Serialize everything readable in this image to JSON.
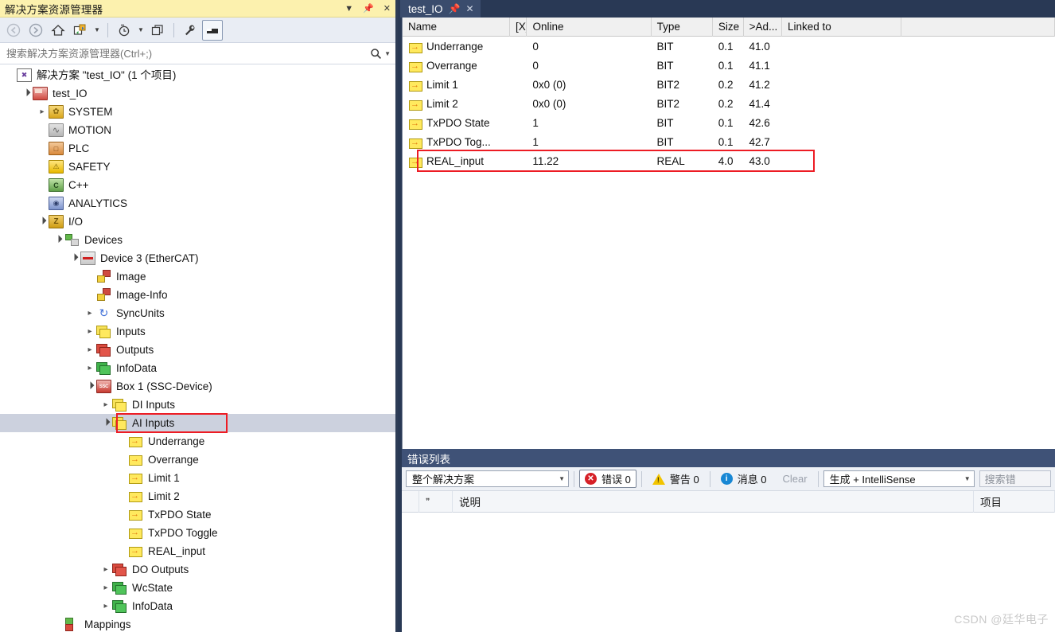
{
  "solution_explorer": {
    "title": "解决方案资源管理器",
    "title_icons": [
      "caret-down-icon",
      "pin-icon",
      "close-icon"
    ],
    "toolbar": {
      "back_label": "back-icon",
      "forward_label": "forward-icon",
      "home_label": "home-icon",
      "sync_label": "sync-with-active-document-icon",
      "pending_changes_label": "pending-changes-icon",
      "refresh_label": "refresh-icon",
      "properties_label": "properties-icon",
      "preview_label": "preview-selected-items-icon"
    },
    "search": {
      "placeholder": "搜索解决方案资源管理器(Ctrl+;)",
      "value": "",
      "icon": "search-icon"
    },
    "tree": [
      {
        "label": "解决方案 \"test_IO\" (1 个项目)",
        "indent": 0,
        "twist": "none",
        "icon": "ic-sln"
      },
      {
        "label": "test_IO",
        "indent": 1,
        "twist": "open",
        "icon": "ic-proj"
      },
      {
        "label": "SYSTEM",
        "indent": 2,
        "twist": "closed",
        "icon": "ic-sys"
      },
      {
        "label": "MOTION",
        "indent": 2,
        "twist": "none",
        "icon": "ic-motion"
      },
      {
        "label": "PLC",
        "indent": 2,
        "twist": "none",
        "icon": "ic-plc"
      },
      {
        "label": "SAFETY",
        "indent": 2,
        "twist": "none",
        "icon": "ic-safety"
      },
      {
        "label": "C++",
        "indent": 2,
        "twist": "none",
        "icon": "ic-cpp"
      },
      {
        "label": "ANALYTICS",
        "indent": 2,
        "twist": "none",
        "icon": "ic-analytics"
      },
      {
        "label": "I/O",
        "indent": 2,
        "twist": "open",
        "icon": "ic-io"
      },
      {
        "label": "Devices",
        "indent": 3,
        "twist": "open",
        "icon": "ic-devices"
      },
      {
        "label": "Device 3 (EtherCAT)",
        "indent": 4,
        "twist": "open",
        "icon": "ic-device3"
      },
      {
        "label": "Image",
        "indent": 5,
        "twist": "none",
        "icon": "ic-image"
      },
      {
        "label": "Image-Info",
        "indent": 5,
        "twist": "none",
        "icon": "ic-image"
      },
      {
        "label": "SyncUnits",
        "indent": 5,
        "twist": "closed",
        "icon": "ic-sync"
      },
      {
        "label": "Inputs",
        "indent": 5,
        "twist": "closed",
        "icon": "ic-yellow"
      },
      {
        "label": "Outputs",
        "indent": 5,
        "twist": "closed",
        "icon": "ic-red"
      },
      {
        "label": "InfoData",
        "indent": 5,
        "twist": "closed",
        "icon": "ic-green"
      },
      {
        "label": "Box 1 (SSC-Device)",
        "indent": 5,
        "twist": "open",
        "icon": "ic-box"
      },
      {
        "label": "DI Inputs",
        "indent": 6,
        "twist": "closed",
        "icon": "ic-yellow"
      },
      {
        "label": "AI Inputs",
        "indent": 6,
        "twist": "open",
        "icon": "ic-yellow",
        "selected": true,
        "highlighted": true
      },
      {
        "label": "Underrange",
        "indent": 7,
        "twist": "none",
        "icon": "ic-var"
      },
      {
        "label": "Overrange",
        "indent": 7,
        "twist": "none",
        "icon": "ic-var"
      },
      {
        "label": "Limit 1",
        "indent": 7,
        "twist": "none",
        "icon": "ic-var"
      },
      {
        "label": "Limit 2",
        "indent": 7,
        "twist": "none",
        "icon": "ic-var"
      },
      {
        "label": "TxPDO State",
        "indent": 7,
        "twist": "none",
        "icon": "ic-var"
      },
      {
        "label": "TxPDO Toggle",
        "indent": 7,
        "twist": "none",
        "icon": "ic-var"
      },
      {
        "label": "REAL_input",
        "indent": 7,
        "twist": "none",
        "icon": "ic-var"
      },
      {
        "label": "DO Outputs",
        "indent": 6,
        "twist": "closed",
        "icon": "ic-red"
      },
      {
        "label": "WcState",
        "indent": 6,
        "twist": "closed",
        "icon": "ic-green"
      },
      {
        "label": "InfoData",
        "indent": 6,
        "twist": "closed",
        "icon": "ic-green"
      },
      {
        "label": "Mappings",
        "indent": 3,
        "twist": "none",
        "icon": "ic-map"
      }
    ],
    "highlight_color": "#ed1c24",
    "selected_row_color": "#ccd1de"
  },
  "document": {
    "tab": {
      "label": "test_IO",
      "pin_icon": "pin-icon",
      "close_icon": "close-icon"
    },
    "table": {
      "columns": [
        "Name",
        "[X]",
        "Online",
        "Type",
        "Size",
        ">Ad...",
        "Linked to",
        ""
      ],
      "rows": [
        {
          "name": "Underrange",
          "x": "",
          "online": "0",
          "type": "BIT",
          "size": "0.1",
          "addr": "41.0",
          "linked": ""
        },
        {
          "name": "Overrange",
          "x": "",
          "online": "0",
          "type": "BIT",
          "size": "0.1",
          "addr": "41.1",
          "linked": ""
        },
        {
          "name": "Limit 1",
          "x": "",
          "online": "0x0 (0)",
          "type": "BIT2",
          "size": "0.2",
          "addr": "41.2",
          "linked": ""
        },
        {
          "name": "Limit 2",
          "x": "",
          "online": "0x0 (0)",
          "type": "BIT2",
          "size": "0.2",
          "addr": "41.4",
          "linked": ""
        },
        {
          "name": "TxPDO State",
          "x": "",
          "online": "1",
          "type": "BIT",
          "size": "0.1",
          "addr": "42.6",
          "linked": ""
        },
        {
          "name": "TxPDO Tog...",
          "x": "",
          "online": "1",
          "type": "BIT",
          "size": "0.1",
          "addr": "42.7",
          "linked": ""
        },
        {
          "name": "REAL_input",
          "x": "",
          "online": "11.22",
          "type": "REAL",
          "size": "4.0",
          "addr": "43.0",
          "linked": "",
          "highlighted": true
        }
      ]
    }
  },
  "error_list": {
    "title": "错误列表",
    "scope": {
      "value": "整个解决方案",
      "caret": "chevron-down-icon"
    },
    "errors": {
      "label": "错误 0",
      "icon": "error-icon",
      "active": true
    },
    "warnings": {
      "label": "警告 0",
      "icon": "warning-icon"
    },
    "messages": {
      "label": "消息 0",
      "icon": "info-icon"
    },
    "clear": {
      "label": "Clear",
      "disabled": true
    },
    "build_filter": {
      "value": "生成 + IntelliSense",
      "caret": "chevron-down-icon"
    },
    "search": {
      "placeholder": "搜索错",
      "value": ""
    },
    "columns": [
      "",
      "",
      "说明",
      "项目"
    ]
  },
  "watermark": "CSDN @廷华电子"
}
